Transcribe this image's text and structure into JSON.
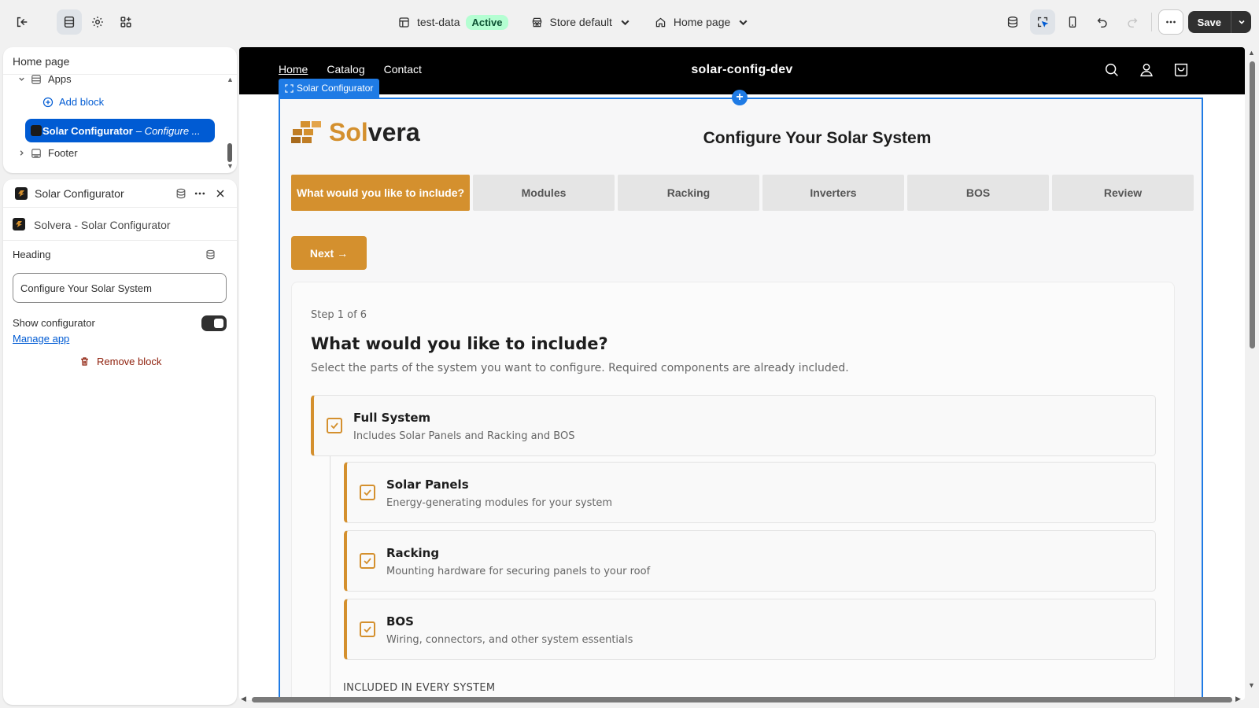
{
  "topbar": {
    "theme_name": "test-data",
    "theme_status": "Active",
    "store_selector": "Store default",
    "page_selector": "Home page",
    "save_label": "Save"
  },
  "tree": {
    "title": "Home page",
    "apps_label": "Apps",
    "add_block": "Add block",
    "selected_block": "Solar Configurator",
    "selected_block_suffix": "– Configure ...",
    "footer_label": "Footer"
  },
  "settings": {
    "title": "Solar Configurator",
    "app_name": "Solvera - Solar Configurator",
    "heading_label": "Heading",
    "heading_value": "Configure Your Solar System",
    "toggle_label": "Show configurator",
    "toggle_on": true,
    "manage_link": "Manage app",
    "remove_label": "Remove block"
  },
  "store": {
    "nav": [
      "Home",
      "Catalog",
      "Contact"
    ],
    "name": "solar-config-dev",
    "section_tag": "Solar Configurator"
  },
  "configurator": {
    "logo_sol": "Sol",
    "logo_vera": "vera",
    "title": "Configure Your Solar System",
    "steps": [
      {
        "label": "What would you like to include?",
        "active": true
      },
      {
        "label": "Modules",
        "active": false
      },
      {
        "label": "Racking",
        "active": false
      },
      {
        "label": "Inverters",
        "active": false
      },
      {
        "label": "BOS",
        "active": false
      },
      {
        "label": "Review",
        "active": false
      }
    ],
    "next_label": "Next →",
    "step_count": "Step 1 of 6",
    "question": "What would you like to include?",
    "question_sub": "Select the parts of the system you want to configure. Required components are already included.",
    "options": [
      {
        "title": "Full System",
        "desc": "Includes Solar Panels and Racking and BOS",
        "checked": true
      },
      {
        "title": "Solar Panels",
        "desc": "Energy-generating modules for your system",
        "checked": true
      },
      {
        "title": "Racking",
        "desc": "Mounting hardware for securing panels to your roof",
        "checked": true
      },
      {
        "title": "BOS",
        "desc": "Wiring, connectors, and other system essentials",
        "checked": true
      }
    ],
    "included_label": "INCLUDED IN EVERY SYSTEM"
  },
  "colors": {
    "accent": "#d4902e",
    "selection": "#1f7be5",
    "primary_blue": "#005bd3"
  }
}
